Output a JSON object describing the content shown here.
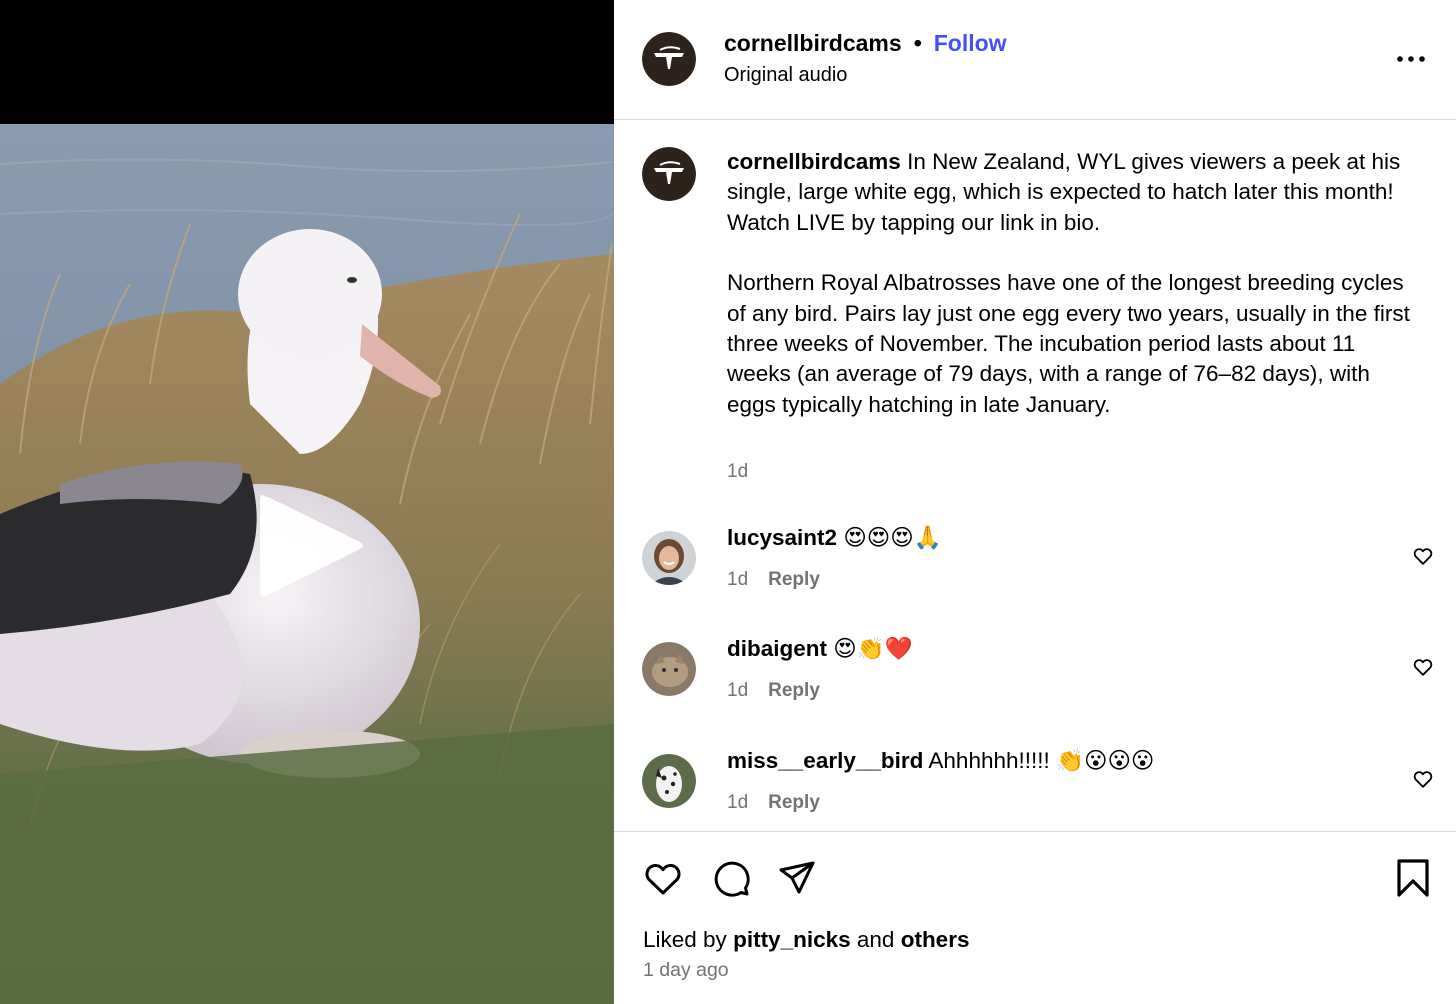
{
  "post": {
    "author": "cornellbirdcams",
    "follow_label": "Follow",
    "separator": "•",
    "audio": "Original audio",
    "caption_paragraph_1": "In New Zealand, WYL gives viewers a peek at his single, large white egg, which is expected to hatch later this month! Watch LIVE by tapping our link in bio.",
    "caption_paragraph_2": "Northern Royal Albatrosses have one of the longest breeding cycles of any bird. Pairs lay just one egg every two years, usually in the first three weeks of November. The incubation period lasts about 11 weeks (an average of 79 days, with a range of 76–82 days), with eggs typically hatching in late January.",
    "caption_time": "1d"
  },
  "comments": [
    {
      "user": "lucysaint2",
      "text": "😍😍😍🙏",
      "time": "1d",
      "reply_label": "Reply"
    },
    {
      "user": "dibaigent",
      "text": "😍👏❤️",
      "time": "1d",
      "reply_label": "Reply"
    },
    {
      "user": "miss__early__bird",
      "text": "Ahhhhhh!!!!! 👏😮😮😮",
      "time": "1d",
      "reply_label": "Reply"
    }
  ],
  "footer": {
    "liked_by_prefix": "Liked by",
    "liked_by_user": "pitty_nicks",
    "and_label": "and",
    "others_label": "others",
    "post_time": "1 day ago"
  },
  "icons": {
    "play": "play-icon",
    "more": "more-options-icon",
    "like": "heart-icon",
    "comment": "comment-icon",
    "share": "share-icon",
    "save": "bookmark-icon"
  },
  "colors": {
    "follow": "#4150f7",
    "secondary_text": "#737373",
    "divider": "#dbdbdb"
  }
}
